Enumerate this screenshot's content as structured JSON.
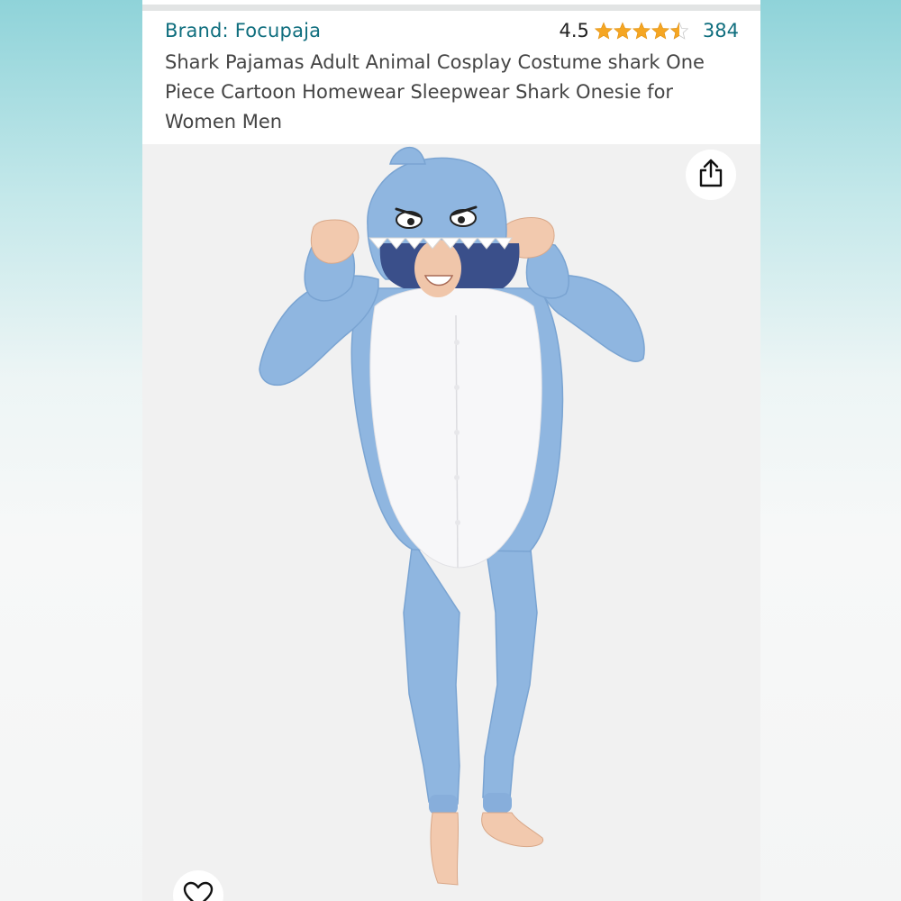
{
  "product": {
    "brand": "Brand: Focupaja",
    "rating": "4.5",
    "rating_fraction": 0.9,
    "review_count": "384",
    "title": "Shark Pajamas Adult Animal Cosplay Costume shark One Piece Cartoon Homewear Sleepwear Shark Onesie for Women Men"
  },
  "icons": {
    "share": "share-icon",
    "wishlist": "heart-icon",
    "rating": "star-icon"
  },
  "colors": {
    "link": "#0f6e7e",
    "star": "#f5a623",
    "costume_blue": "#8fb8e3",
    "costume_belly": "#f7f7f9"
  }
}
